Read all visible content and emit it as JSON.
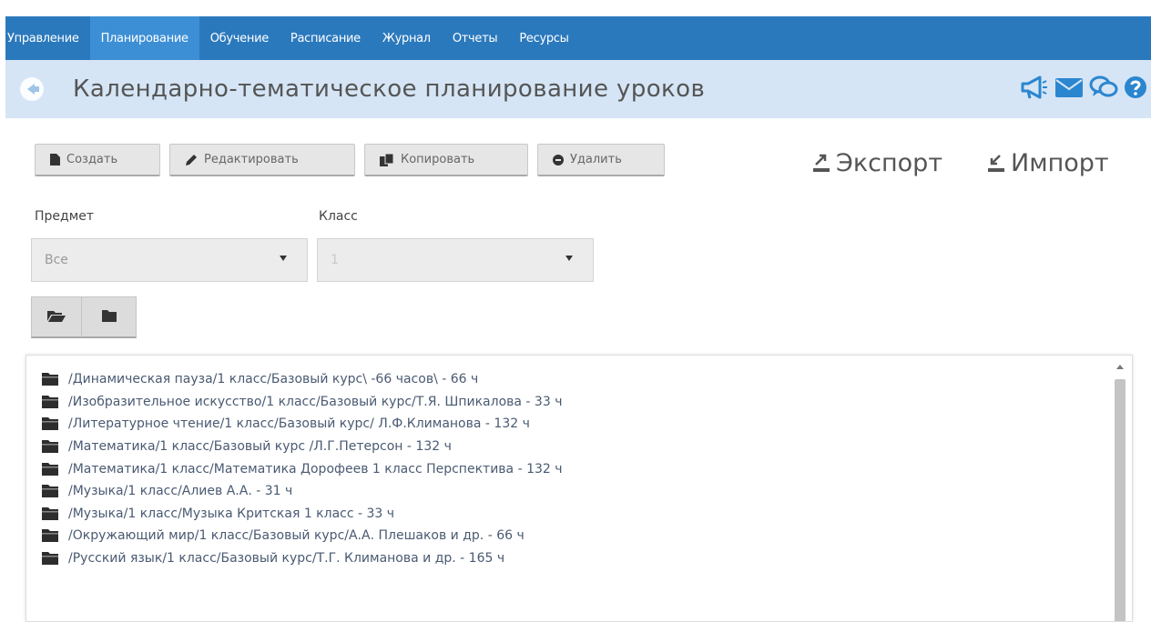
{
  "nav": {
    "items": [
      {
        "label": "Управление"
      },
      {
        "label": "Планирование"
      },
      {
        "label": "Обучение"
      },
      {
        "label": "Расписание"
      },
      {
        "label": "Журнал"
      },
      {
        "label": "Отчеты"
      },
      {
        "label": "Ресурсы"
      }
    ],
    "active_index": 1
  },
  "header": {
    "title": "Календарно-тематическое планирование уроков",
    "icons": [
      "megaphone-icon",
      "mail-icon",
      "chat-icon",
      "help-icon"
    ]
  },
  "toolbar": {
    "create_label": "Создать",
    "edit_label": "Редактировать",
    "copy_label": "Копировать",
    "delete_label": "Удалить",
    "export_label": "Экспорт",
    "import_label": "Импорт"
  },
  "filters": {
    "subject_label": "Предмет",
    "subject_value": "Все",
    "class_label": "Класс",
    "class_value": "1"
  },
  "tree": {
    "items": [
      {
        "label": "/Динамическая пауза/1 класс/Базовый курс\\ -66 часов\\ - 66 ч"
      },
      {
        "label": "/Изобразительное искусство/1 класс/Базовый курс/Т.Я. Шпикалова - 33 ч"
      },
      {
        "label": "/Литературное чтение/1 класс/Базовый курс/ Л.Ф.Климанова - 132 ч"
      },
      {
        "label": "/Математика/1 класс/Базовый курс /Л.Г.Петерсон - 132 ч"
      },
      {
        "label": "/Математика/1 класс/Математика Дорофеев 1 класс Перспектива - 132 ч"
      },
      {
        "label": "/Музыка/1 класс/Алиев А.А. - 31 ч"
      },
      {
        "label": "/Музыка/1 класс/Музыка Критская 1 класс - 33 ч"
      },
      {
        "label": "/Окружающий мир/1 класс/Базовый курс/А.А. Плешаков и др. - 66 ч"
      },
      {
        "label": "/Русский язык/1 класс/Базовый курс/Т.Г. Климанова и др. - 165 ч"
      }
    ]
  },
  "colors": {
    "nav_bg": "#2b79bd",
    "nav_active": "#3d8fd5",
    "title_bar": "#d5e5f5",
    "accent_icons": "#2b86d0"
  }
}
